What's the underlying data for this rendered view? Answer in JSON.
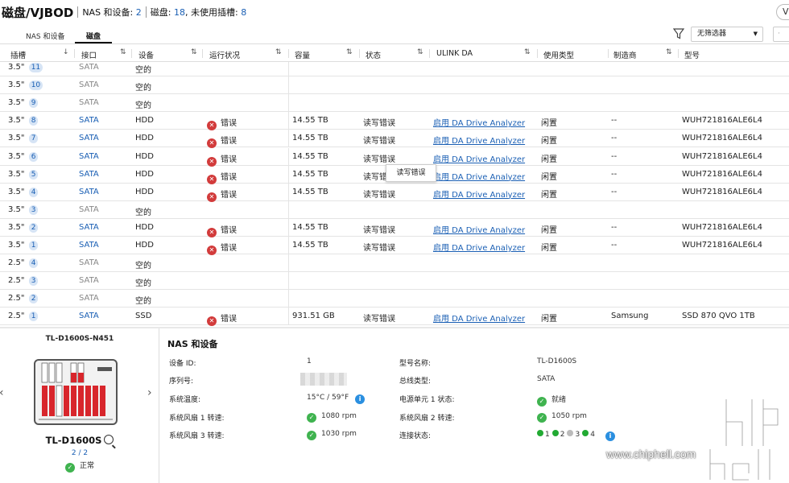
{
  "header": {
    "title": "磁盘/VJBOD",
    "nas_label": "NAS 和设备:",
    "nas_count": "2",
    "disks_label": "磁盘:",
    "disks_count": "18",
    "unused_label": ", 未使用插槽:",
    "unused_count": "8",
    "corner_btn": "V"
  },
  "tabs": [
    {
      "label": "NAS 和设备"
    },
    {
      "label": "磁盘"
    }
  ],
  "filter": {
    "value": "无筛选器"
  },
  "columns": [
    "插槽",
    "接口",
    "设备",
    "运行状况",
    "容量",
    "状态",
    "ULINK DA",
    "使用类型",
    "制造商",
    "型号"
  ],
  "rows": [
    {
      "slot": "3.5\"",
      "num": "11",
      "iface": "SATA",
      "device": "空的",
      "health": "",
      "capacity": "",
      "state": "",
      "ulink": "",
      "usage": "",
      "maker": "",
      "model": ""
    },
    {
      "slot": "3.5\"",
      "num": "10",
      "iface": "SATA",
      "device": "空的",
      "health": "",
      "capacity": "",
      "state": "",
      "ulink": "",
      "usage": "",
      "maker": "",
      "model": ""
    },
    {
      "slot": "3.5\"",
      "num": "9",
      "iface": "SATA",
      "device": "空的",
      "health": "",
      "capacity": "",
      "state": "",
      "ulink": "",
      "usage": "",
      "maker": "",
      "model": ""
    },
    {
      "slot": "3.5\"",
      "num": "8",
      "iface": "SATA",
      "device": "HDD",
      "health": "错误",
      "capacity": "14.55 TB",
      "state": "读写错误",
      "ulink": "启用 DA Drive Analyzer",
      "usage": "闲置",
      "maker": "--",
      "model": "WUH721816ALE6L4"
    },
    {
      "slot": "3.5\"",
      "num": "7",
      "iface": "SATA",
      "device": "HDD",
      "health": "错误",
      "capacity": "14.55 TB",
      "state": "读写错误",
      "ulink": "启用 DA Drive Analyzer",
      "usage": "闲置",
      "maker": "--",
      "model": "WUH721816ALE6L4"
    },
    {
      "slot": "3.5\"",
      "num": "6",
      "iface": "SATA",
      "device": "HDD",
      "health": "错误",
      "capacity": "14.55 TB",
      "state": "读写错误",
      "ulink": "启用 DA Drive Analyzer",
      "usage": "闲置",
      "maker": "--",
      "model": "WUH721816ALE6L4"
    },
    {
      "slot": "3.5\"",
      "num": "5",
      "iface": "SATA",
      "device": "HDD",
      "health": "错误",
      "capacity": "14.55 TB",
      "state": "读写错误",
      "ulink": "启用 DA Drive Analyzer",
      "usage": "闲置",
      "maker": "--",
      "model": "WUH721816ALE6L4"
    },
    {
      "slot": "3.5\"",
      "num": "4",
      "iface": "SATA",
      "device": "HDD",
      "health": "错误",
      "capacity": "14.55 TB",
      "state": "读写错误",
      "ulink": "启用 DA Drive Analyzer",
      "usage": "闲置",
      "maker": "--",
      "model": "WUH721816ALE6L4"
    },
    {
      "slot": "3.5\"",
      "num": "3",
      "iface": "SATA",
      "device": "空的",
      "health": "",
      "capacity": "",
      "state": "",
      "ulink": "",
      "usage": "",
      "maker": "",
      "model": ""
    },
    {
      "slot": "3.5\"",
      "num": "2",
      "iface": "SATA",
      "device": "HDD",
      "health": "错误",
      "capacity": "14.55 TB",
      "state": "读写错误",
      "ulink": "启用 DA Drive Analyzer",
      "usage": "闲置",
      "maker": "--",
      "model": "WUH721816ALE6L4"
    },
    {
      "slot": "3.5\"",
      "num": "1",
      "iface": "SATA",
      "device": "HDD",
      "health": "错误",
      "capacity": "14.55 TB",
      "state": "读写错误",
      "ulink": "启用 DA Drive Analyzer",
      "usage": "闲置",
      "maker": "--",
      "model": "WUH721816ALE6L4"
    },
    {
      "slot": "2.5\"",
      "num": "4",
      "iface": "SATA",
      "device": "空的",
      "health": "",
      "capacity": "",
      "state": "",
      "ulink": "",
      "usage": "",
      "maker": "",
      "model": ""
    },
    {
      "slot": "2.5\"",
      "num": "3",
      "iface": "SATA",
      "device": "空的",
      "health": "",
      "capacity": "",
      "state": "",
      "ulink": "",
      "usage": "",
      "maker": "",
      "model": ""
    },
    {
      "slot": "2.5\"",
      "num": "2",
      "iface": "SATA",
      "device": "空的",
      "health": "",
      "capacity": "",
      "state": "",
      "ulink": "",
      "usage": "",
      "maker": "",
      "model": ""
    },
    {
      "slot": "2.5\"",
      "num": "1",
      "iface": "SATA",
      "device": "SSD",
      "health": "错误",
      "capacity": "931.51 GB",
      "state": "读写错误",
      "ulink": "启用 DA Drive Analyzer",
      "usage": "闲置",
      "maker": "Samsung",
      "model": "SSD 870 QVO 1TB"
    }
  ],
  "tooltip": "读写错误",
  "device_panel": {
    "name": "TL-D1600S-N451",
    "model": "TL-D1600S",
    "count": "2 / 2",
    "status": "正常"
  },
  "details": {
    "title": "NAS 和设备",
    "device_id_label": "设备 ID:",
    "device_id": "1",
    "serial_label": "序列号:",
    "temp_label": "系统温度:",
    "temp": "15°C / 59°F",
    "fan1_label": "系统风扇 1 转速:",
    "fan1": "1080 rpm",
    "fan3_label": "系统风扇 3 转速:",
    "fan3": "1030 rpm",
    "model_label": "型号名称:",
    "model": "TL-D1600S",
    "bus_label": "总线类型:",
    "bus": "SATA",
    "psu_label": "电源单元 1 状态:",
    "psu": "就绪",
    "fan2_label": "系统风扇 2 转速:",
    "fan2": "1050 rpm",
    "conn_label": "连接状态:",
    "conn": [
      {
        "n": "1",
        "color": "#22aa33"
      },
      {
        "n": "2",
        "color": "#22aa33"
      },
      {
        "n": "3",
        "color": "#bbbbbb"
      },
      {
        "n": "4",
        "color": "#22aa33"
      }
    ]
  },
  "watermark": {
    "url": "www.chiphell.com"
  }
}
